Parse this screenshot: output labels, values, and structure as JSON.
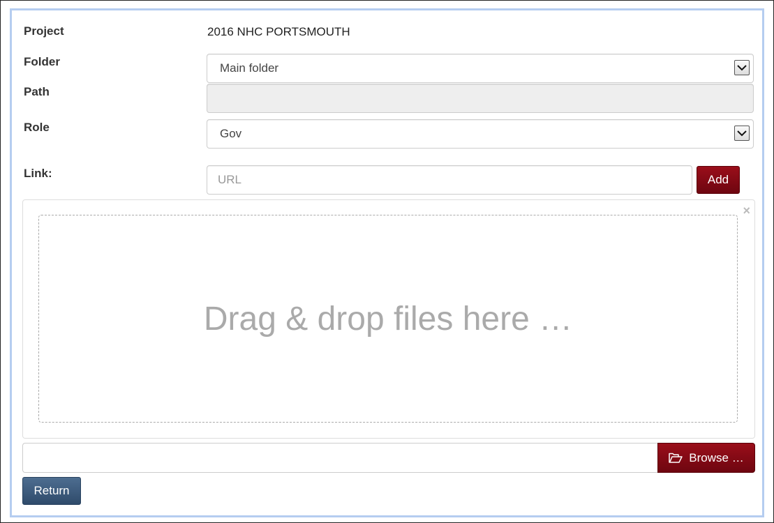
{
  "form": {
    "project": {
      "label": "Project",
      "value": "2016 NHC PORTSMOUTH"
    },
    "folder": {
      "label": "Folder",
      "selected": "Main folder"
    },
    "path": {
      "label": "Path",
      "value": ""
    },
    "role": {
      "label": "Role",
      "selected": "Gov"
    },
    "link": {
      "label": "Link:",
      "placeholder": "URL",
      "value": "",
      "add_label": "Add"
    }
  },
  "upload": {
    "drop_text": "Drag & drop files here …",
    "close_glyph": "×",
    "caption": "",
    "browse_label": "Browse …",
    "browse_icon": "folder-open-icon"
  },
  "actions": {
    "return_label": "Return"
  },
  "colors": {
    "accent_red": "#7f0a14",
    "return_blue": "#3d5a7c",
    "frame_border": "#b5cdf0"
  }
}
